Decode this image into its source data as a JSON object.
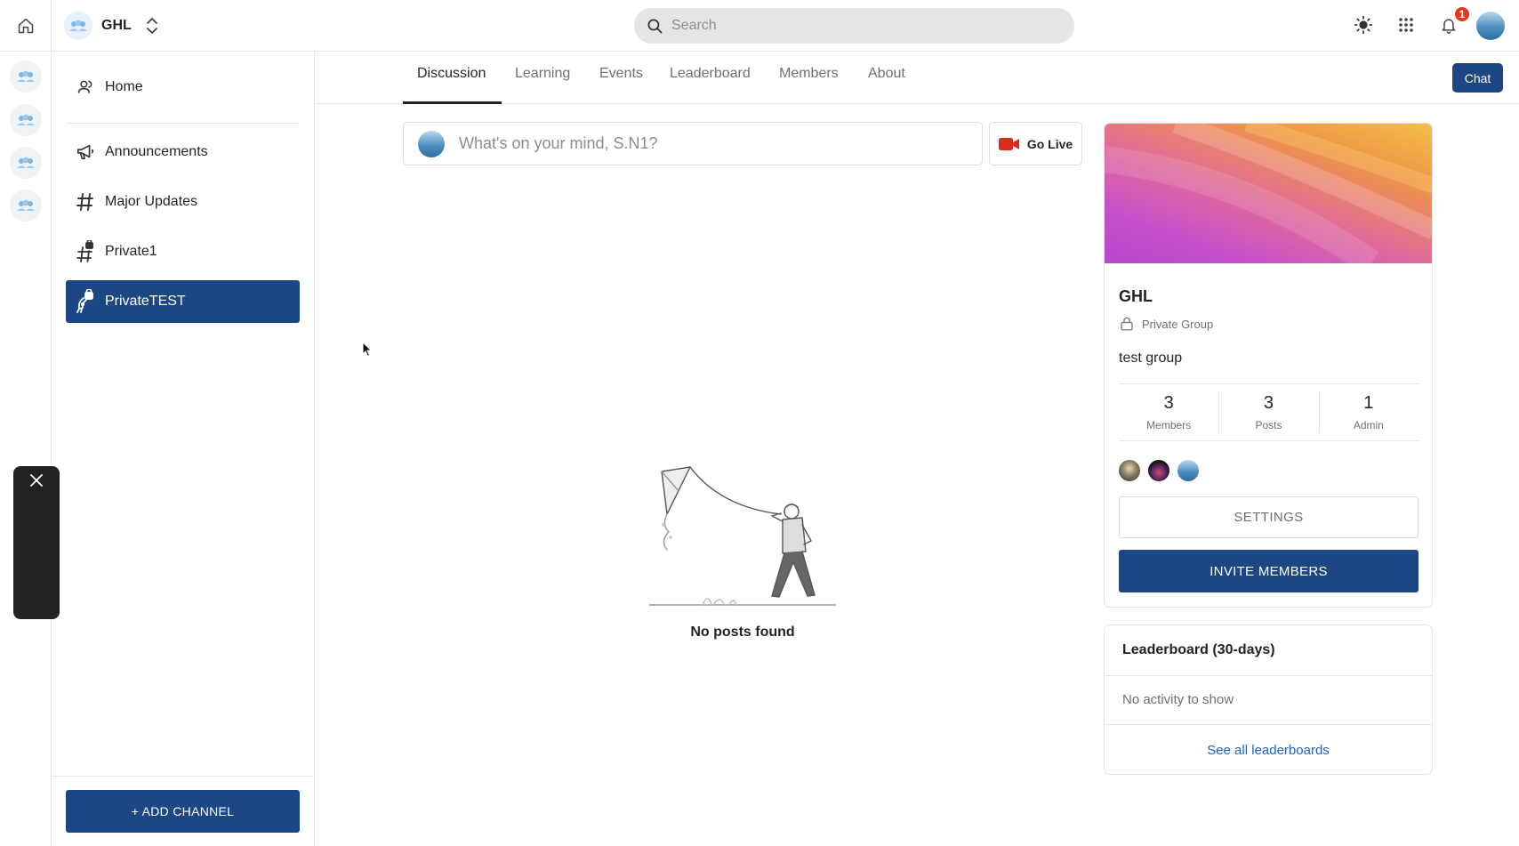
{
  "topbar": {
    "group_name": "GHL",
    "search_placeholder": "Search",
    "notification_count": "1",
    "icons": [
      "home-icon",
      "chevron-updown-icon",
      "search-icon",
      "sun-icon",
      "apps-grid-icon",
      "bell-icon"
    ]
  },
  "rail": {
    "groups": [
      "group-1",
      "group-2",
      "group-3",
      "group-4"
    ]
  },
  "sidebar": {
    "home_label": "Home",
    "channels": [
      {
        "label": "Announcements",
        "icon": "megaphone-icon"
      },
      {
        "label": "Major Updates",
        "icon": "hashtag-icon"
      },
      {
        "label": "Private1",
        "icon": "locked-hashtag-icon"
      },
      {
        "label": "PrivateTEST",
        "icon": "locked-rocket-icon",
        "active": true
      }
    ],
    "add_channel_label": "+ ADD CHANNEL"
  },
  "tabs": [
    "Discussion",
    "Learning",
    "Events",
    "Leaderboard",
    "Members",
    "About"
  ],
  "active_tab": "Discussion",
  "chat_label": "Chat",
  "composer": {
    "placeholder": "What's on your mind, S.N1?",
    "go_live_label": "Go Live"
  },
  "feed": {
    "empty_text": "No posts found"
  },
  "group_card": {
    "name": "GHL",
    "privacy": "Private Group",
    "description": "test group",
    "stats": [
      {
        "value": "3",
        "label": "Members"
      },
      {
        "value": "3",
        "label": "Posts"
      },
      {
        "value": "1",
        "label": "Admin"
      }
    ],
    "settings_label": "SETTINGS",
    "invite_label": "INVITE MEMBERS"
  },
  "leaderboard": {
    "title": "Leaderboard (30-days)",
    "empty_text": "No activity to show",
    "link_label": "See all leaderboards"
  },
  "colors": {
    "primary": "#1c4784",
    "link": "#1c5fd1",
    "badge": "#e5371d",
    "golive_red": "#d62d20"
  }
}
